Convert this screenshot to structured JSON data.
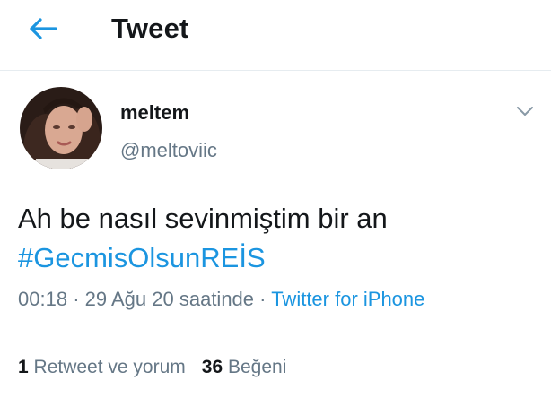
{
  "header": {
    "title": "Tweet",
    "back_icon": "arrow-left-icon"
  },
  "author": {
    "display_name": "meltem",
    "handle": "@meltoviic"
  },
  "tweet": {
    "text": "Ah be nasıl sevinmiştim bir an",
    "hashtag": "#GecmisOlsunREİS",
    "time": "00:18",
    "date": "29 Ağu 20 saatinde",
    "source": "Twitter for iPhone"
  },
  "stats": {
    "retweets_count": "1",
    "retweets_label": "Retweet ve yorum",
    "likes_count": "36",
    "likes_label": "Beğeni"
  },
  "colors": {
    "accent": "#1b95e0",
    "text": "#14171a",
    "muted": "#657786",
    "border": "#e6ecf0"
  }
}
